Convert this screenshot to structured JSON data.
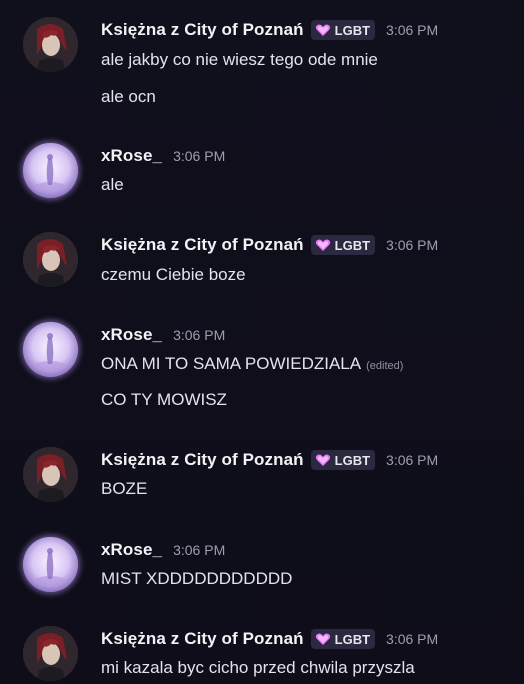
{
  "users": {
    "ksiezna": {
      "name": "Księżna z City of Poznań",
      "tag": "LGBT"
    },
    "xrose": {
      "name": "xRose_"
    }
  },
  "messages": [
    {
      "author": "Księżna z City of Poznań",
      "tag": "LGBT",
      "time": "3:06 PM",
      "lines": [
        "ale jakby co nie wiesz tego ode mnie",
        "ale ocn"
      ]
    },
    {
      "author": "xRose_",
      "time": "3:06 PM",
      "lines": [
        "ale"
      ]
    },
    {
      "author": "Księżna z City of Poznań",
      "tag": "LGBT",
      "time": "3:06 PM",
      "lines": [
        "czemu Ciebie boze"
      ]
    },
    {
      "author": "xRose_",
      "time": "3:06 PM",
      "lines": [
        "ONA MI TO SAMA POWIEDZIALA",
        "CO TY MOWISZ"
      ],
      "edited_label": "(edited)"
    },
    {
      "author": "Księżna z City of Poznań",
      "tag": "LGBT",
      "time": "3:06 PM",
      "lines": [
        "BOZE"
      ]
    },
    {
      "author": "xRose_",
      "time": "3:06 PM",
      "lines": [
        "MIST XDDDDDDDDDDD"
      ]
    },
    {
      "author": "Księżna z City of Poznań",
      "tag": "LGBT",
      "time": "3:06 PM",
      "lines": [
        "mi kazala byc cicho przed chwila przyszla"
      ]
    }
  ],
  "colors": {
    "background": "#0f0e1a",
    "username": "#f2f3f5",
    "timestamp": "#9c9fae",
    "tag_bg": "#2a2940",
    "heart": "#e879f9"
  }
}
